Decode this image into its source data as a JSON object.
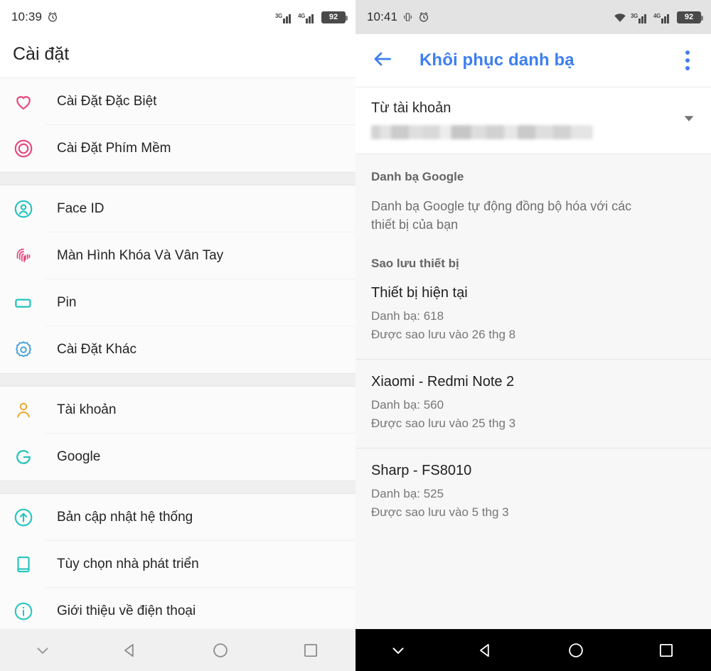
{
  "left": {
    "status": {
      "time": "10:39",
      "alarm_icon": "alarm-icon",
      "signal_1": "3G",
      "signal_2": "4G",
      "battery": "92"
    },
    "title": "Cài đặt",
    "groups": [
      {
        "items": [
          {
            "icon": "heart-icon",
            "color": "#e8457c",
            "label": "Cài Đặt Đặc Biệt"
          },
          {
            "icon": "target-icon",
            "color": "#e8457c",
            "label": "Cài Đặt Phím Mềm"
          }
        ]
      },
      {
        "items": [
          {
            "icon": "face-id-icon",
            "color": "#23c4bd",
            "label": "Face ID"
          },
          {
            "icon": "fingerprint-icon",
            "color": "#e8457c",
            "label": "Màn Hình Khóa Và Vân Tay"
          },
          {
            "icon": "battery-icon",
            "color": "#23c4bd",
            "label": "Pin"
          },
          {
            "icon": "gear-icon",
            "color": "#44a0d6",
            "label": "Cài Đặt Khác"
          }
        ]
      },
      {
        "items": [
          {
            "icon": "person-icon",
            "color": "#e9ad3c",
            "label": "Tài khoản"
          },
          {
            "icon": "google-g-icon",
            "color": "#23c4bd",
            "label": "Google"
          }
        ]
      },
      {
        "items": [
          {
            "icon": "arrow-up-circle-icon",
            "color": "#23c4bd",
            "label": "Bản cập nhật hệ thống"
          },
          {
            "icon": "book-icon",
            "color": "#23c4bd",
            "label": "Tùy chọn nhà phát triển"
          },
          {
            "icon": "info-circle-icon",
            "color": "#23c4bd",
            "label": "Giới thiệu về điện thoại"
          }
        ]
      }
    ],
    "nav": {
      "hide_label": "chevron-down-icon",
      "back_label": "back-triangle-icon",
      "home_label": "home-circle-icon",
      "recents_label": "recents-square-icon"
    }
  },
  "right": {
    "status": {
      "time": "10:41",
      "vibrate_icon": "vibrate-icon",
      "alarm_icon": "alarm-icon",
      "wifi_icon": "wifi-icon",
      "signal_1": "3G",
      "signal_2": "4G",
      "battery": "92"
    },
    "appbar": {
      "back_icon": "back-arrow-icon",
      "title": "Khôi phục danh bạ",
      "menu_icon": "overflow-menu-icon",
      "title_color": "#3d7ff0"
    },
    "account": {
      "label": "Từ tài khoản",
      "value": "",
      "caret_icon": "dropdown-caret-icon"
    },
    "google_section": {
      "header": "Danh bạ Google",
      "body": "Danh bạ Google tự động đồng bộ hóa với các thiết bị của bạn"
    },
    "backup_section": {
      "header": "Sao lưu thiết bị"
    },
    "devices": [
      {
        "name": "Thiết bị hiện tại",
        "contacts": "Danh bạ: 618",
        "backed_up": "Được sao lưu vào 26 thg 8"
      },
      {
        "name": "Xiaomi - Redmi Note 2",
        "contacts": "Danh bạ: 560",
        "backed_up": "Được sao lưu vào 25 thg 3"
      },
      {
        "name": "Sharp - FS8010",
        "contacts": "Danh bạ: 525",
        "backed_up": "Được sao lưu vào 5 thg 3"
      }
    ],
    "nav": {
      "hide_label": "chevron-down-icon",
      "back_label": "back-triangle-icon",
      "home_label": "home-circle-icon",
      "recents_label": "recents-square-icon"
    }
  }
}
